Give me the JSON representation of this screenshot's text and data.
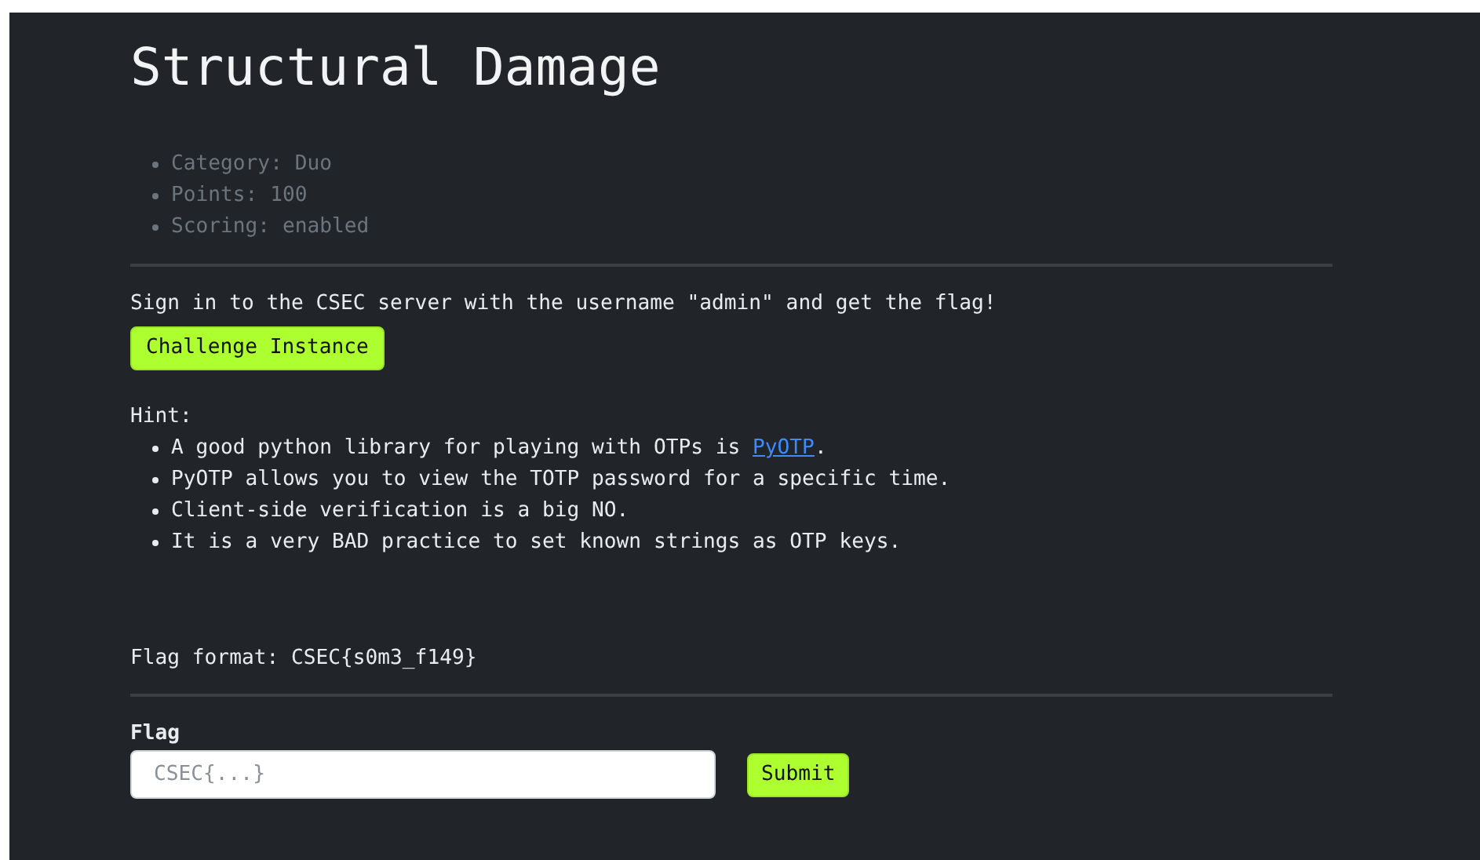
{
  "title": "Structural Damage",
  "meta": [
    "Category: Duo",
    "Points: 100",
    "Scoring: enabled"
  ],
  "description": "Sign in to the CSEC server with the username \"admin\" and get the flag!",
  "challenge_button": "Challenge Instance",
  "hint_label": "Hint:",
  "hints": [
    {
      "text": "A good python library for playing with OTPs is ",
      "link": "PyOTP",
      "after": "."
    },
    {
      "text": "PyOTP allows you to view the TOTP password for a specific time."
    },
    {
      "text": "Client-side verification is a big NO."
    },
    {
      "text": "It is a very BAD practice to set known strings as OTP keys."
    }
  ],
  "flag_format": "Flag format: CSEC{s0m3_f149}",
  "form": {
    "label": "Flag",
    "placeholder": "CSEC{...}",
    "submit": "Submit"
  }
}
